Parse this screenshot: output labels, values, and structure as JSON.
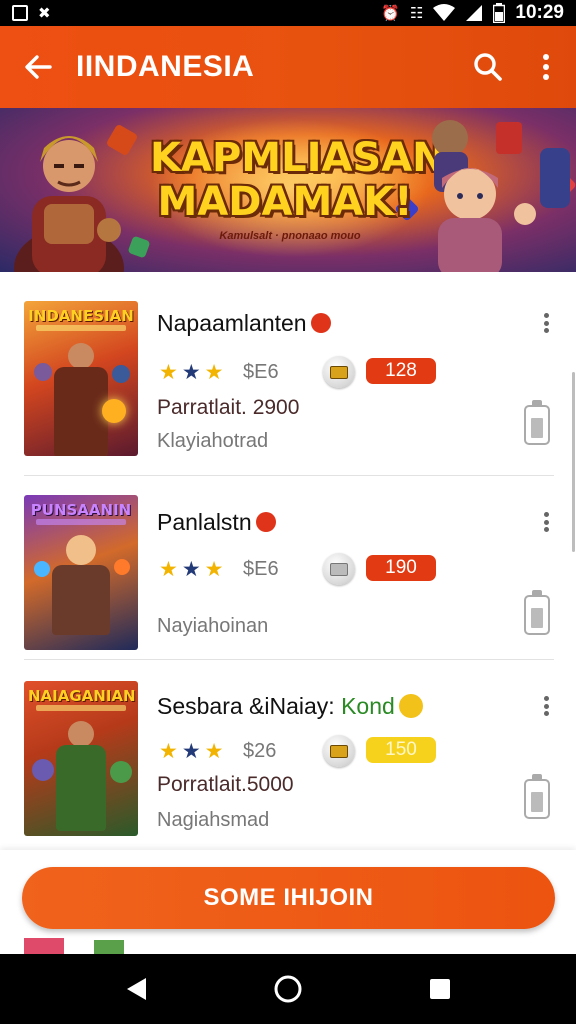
{
  "status_bar": {
    "time": "10:29",
    "left_icons": [
      "image-icon",
      "x-icon"
    ],
    "right_icons": [
      "alarm-icon",
      "vibrate-icon",
      "wifi-icon",
      "signal-icon",
      "battery-icon"
    ]
  },
  "app_bar": {
    "title": "IINDANESIA",
    "back_icon": "arrow-left-icon",
    "search_icon": "search-icon",
    "more_icon": "more-vert-icon",
    "color": "#e8520f"
  },
  "banner": {
    "title_line1": "KAPMLIASANI",
    "title_line2": "MADAMAK!",
    "subtitle": "Kamulsalt · pnonaao mouo"
  },
  "items": [
    {
      "thumb_label": "INDANESIAN",
      "title": "Napaamlanten",
      "title_accent": "",
      "badge_color": "#e0341a",
      "stars": [
        "gold",
        "navy",
        "gold"
      ],
      "price": "$E6",
      "pill": "128",
      "pill_color": "red",
      "meta1": "Parratlait. 2900",
      "meta2": "Klayiahotrad"
    },
    {
      "thumb_label": "PUNSAANIN",
      "title": "Panlalstn",
      "title_accent": "",
      "badge_color": "#e0341a",
      "stars": [
        "gold",
        "navy",
        "gold"
      ],
      "price": "$E6",
      "pill": "190",
      "pill_color": "red",
      "meta1": "",
      "meta2": "Nayiahoinan"
    },
    {
      "thumb_label": "NAIAGANIAN",
      "title": "Sesbara &iNaiay: ",
      "title_accent": "Kond",
      "badge_color": "#f2c21a",
      "stars": [
        "gold",
        "navy",
        "gold"
      ],
      "price": "$26",
      "pill": "150",
      "pill_color": "yellow",
      "meta1": "Porratlait.5000",
      "meta2": "Nagiahsmad"
    }
  ],
  "cta": {
    "label": "SOME IHIJOIN",
    "color": "#ec5410"
  },
  "nav_bar": {
    "back": "triangle-back-icon",
    "home": "circle-home-icon",
    "recents": "square-recents-icon"
  }
}
